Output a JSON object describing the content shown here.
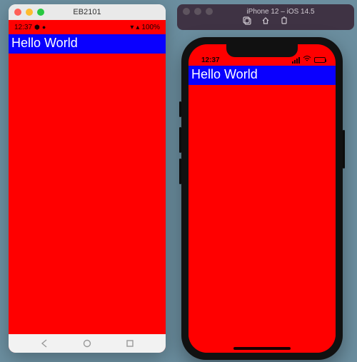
{
  "android": {
    "window_title": "EB2101",
    "status": {
      "time": "12:37",
      "battery": "100%"
    },
    "app": {
      "hello_text": "Hello World"
    }
  },
  "ios": {
    "window_title": "iPhone 12 – iOS 14.5",
    "status": {
      "time": "12:37"
    },
    "app": {
      "hello_text": "Hello World"
    }
  },
  "colors": {
    "app_bg": "#ff0000",
    "bar_bg": "#0a00ff",
    "bar_text": "#ffffff"
  }
}
